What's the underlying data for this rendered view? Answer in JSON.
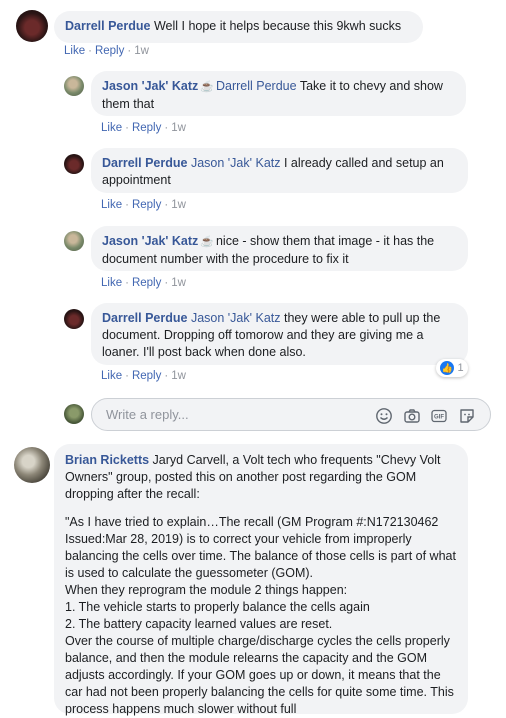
{
  "comments": [
    {
      "author": "Darrell Perdue",
      "text": "Well I hope it helps because this 9kwh sucks",
      "like": "Like",
      "reply": "Reply",
      "time": "1w"
    },
    {
      "author": "Jason 'Jak' Katz",
      "mention": "Darrell Perdue",
      "text": "Take it to chevy and show them that",
      "like": "Like",
      "reply": "Reply",
      "time": "1w"
    },
    {
      "author": "Darrell Perdue",
      "mention": "Jason 'Jak' Katz",
      "text": "I already called and setup an appointment",
      "like": "Like",
      "reply": "Reply",
      "time": "1w"
    },
    {
      "author": "Jason 'Jak' Katz",
      "text": "nice - show them that image - it has the document number with the procedure to fix it",
      "like": "Like",
      "reply": "Reply",
      "time": "1w"
    },
    {
      "author": "Darrell Perdue",
      "mention": "Jason 'Jak' Katz",
      "text": "they were able to pull up the document. Dropping off tomorow and they are giving me a loaner. I'll post back when done also.",
      "like": "Like",
      "reply": "Reply",
      "time": "1w",
      "reaction_count": "1"
    }
  ],
  "reply_box": {
    "placeholder": "Write a reply..."
  },
  "bottom_comment": {
    "author": "Brian Ricketts",
    "intro": "Jaryd Carvell, a Volt tech who frequents \"Chevy Volt Owners\" group, posted this on another post regarding the GOM dropping after the recall:",
    "quote_lines": [
      "\"As I have tried to explain…The recall (GM Program #:N172130462 Issued:Mar 28, 2019) is to correct your vehicle from improperly balancing the cells over time. The balance of those cells is part of what is used to calculate the guessometer (GOM).",
      "When they reprogram the module 2 things happen:",
      "1. The vehicle starts to properly balance the cells again",
      "2. The battery capacity learned values are reset.",
      "Over the course of multiple charge/discharge cycles the cells properly balance, and then the module relearns the capacity and the GOM adjusts accordingly. If your GOM goes up or down, it means that the car had not been properly balancing the cells for quite some time. This process happens much slower without full"
    ]
  },
  "colors": {
    "link": "#385898",
    "action_link": "#4267b2",
    "bubble": "#f2f3f5",
    "meta": "#90949c"
  }
}
